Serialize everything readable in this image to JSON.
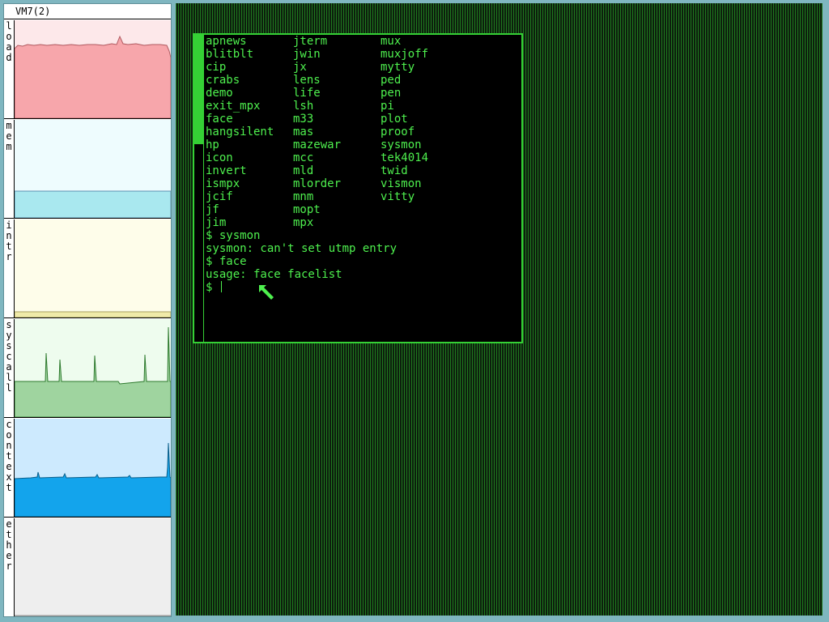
{
  "sysmon": {
    "title": "VM7(2)",
    "meters": [
      {
        "label": "load",
        "bg": "#fde8ea",
        "fill": "#f7a6ab",
        "line": "#b05a60"
      },
      {
        "label": "mem",
        "bg": "#eefcfe",
        "fill": "#a9e8ef",
        "line": "#5c8fb0"
      },
      {
        "label": "intr",
        "bg": "#fefdea",
        "fill": "#f0eaa9",
        "line": "#a8a060"
      },
      {
        "label": "syscall",
        "bg": "#eefcee",
        "fill": "#9fd49f",
        "line": "#2e7a2e"
      },
      {
        "label": "context",
        "bg": "#cdeafe",
        "fill": "#13a4ec",
        "line": "#0b5f8a"
      },
      {
        "label": "ether",
        "bg": "#eeeeee",
        "fill": "#dddddd",
        "line": "#999999"
      }
    ]
  },
  "terminal": {
    "menu_columns": [
      [
        "apnews",
        "blitblt",
        "cip",
        "crabs",
        "demo",
        "exit_mpx",
        "face",
        "hangsilent",
        "hp",
        "icon",
        "invert",
        "ismpx",
        "jcif",
        "jf",
        "jim"
      ],
      [
        "jterm",
        "jwin",
        "jx",
        "lens",
        "life",
        "lsh",
        "m33",
        "mas",
        "mazewar",
        "mcc",
        "mld",
        "mlorder",
        "mnm",
        "mopt",
        "mpx"
      ],
      [
        "mux",
        "muxjoff",
        "mytty",
        "ped",
        "pen",
        "pi",
        "plot",
        "proof",
        "sysmon",
        "tek4014",
        "twid",
        "vismon",
        "vitty"
      ]
    ],
    "session": [
      "$ sysmon",
      "sysmon: can't set utmp entry",
      "$ face",
      "usage: face facelist"
    ],
    "prompt": "$",
    "colors": {
      "text": "#4ef04e",
      "border": "#35d035",
      "background": "#000000"
    }
  },
  "desktop": {
    "color": "#1f7a1f"
  }
}
